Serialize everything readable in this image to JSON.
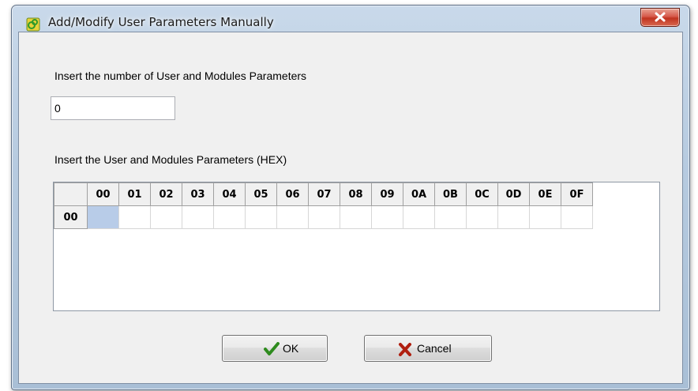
{
  "window": {
    "title": "Add/Modify User Parameters Manually",
    "close_label": "x"
  },
  "form": {
    "count_label": "Insert the number of User and Modules Parameters",
    "count_value": "0",
    "params_label": "Insert the User and Modules Parameters (HEX)"
  },
  "grid": {
    "columns": [
      "00",
      "01",
      "02",
      "03",
      "04",
      "05",
      "06",
      "07",
      "08",
      "09",
      "0A",
      "0B",
      "0C",
      "0D",
      "0E",
      "0F"
    ],
    "rows": [
      {
        "header": "00",
        "cells": [
          "",
          "",
          "",
          "",
          "",
          "",
          "",
          "",
          "",
          "",
          "",
          "",
          "",
          "",
          "",
          ""
        ],
        "selected_index": 0
      }
    ]
  },
  "buttons": {
    "ok_label": "OK",
    "cancel_label": "Cancel"
  },
  "icons": {
    "app": "app-cube-icon",
    "ok": "checkmark-icon",
    "cancel": "x-mark-icon"
  },
  "colors": {
    "ok_check": "#2e8b1e",
    "cancel_x": "#b01f10",
    "selected_cell": "#b8cce8"
  }
}
